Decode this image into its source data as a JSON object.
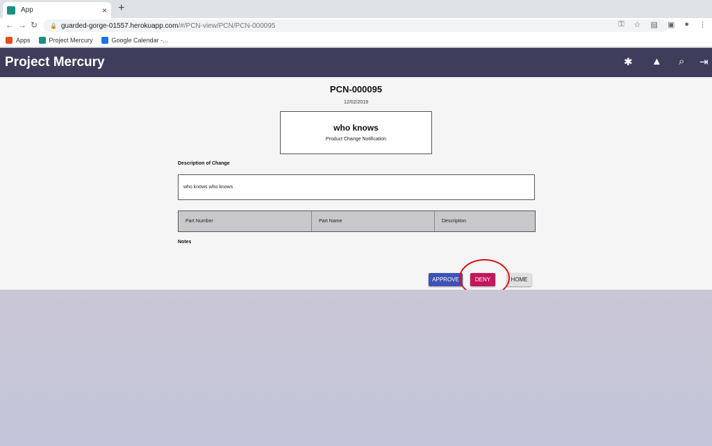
{
  "browser": {
    "tab_title": "App",
    "tab_close": "×",
    "new_tab": "+",
    "url_host": "guarded-gorge-01557.herokuapp.com",
    "url_path": "/#/PCN-view/PCN/PCN-000095",
    "bookmarks": [
      "Apps",
      "Project Mercury",
      "Google Calendar -..."
    ]
  },
  "header": {
    "title": "Project Mercury"
  },
  "pcn": {
    "id": "PCN-000095",
    "date": "12/02/2019",
    "name": "who knows",
    "type": "Product Change Notification",
    "description_label": "Description of Change",
    "description": "who knows who knows",
    "notes_label": "Notes"
  },
  "parts_table": {
    "columns": [
      "Part Number",
      "Part Name",
      "Description"
    ]
  },
  "actions": {
    "approve": "APPROVE",
    "deny": "DENY",
    "home": "HOME"
  },
  "colors": {
    "header_bg": "#3f3d5c",
    "approve": "#3f51b5",
    "deny": "#c2185b",
    "highlight": "#e01010"
  }
}
